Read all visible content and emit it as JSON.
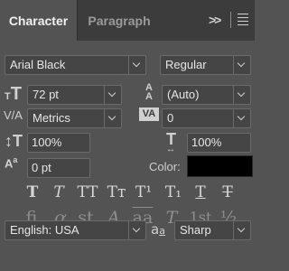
{
  "tabs": {
    "active": "Character",
    "inactive": "Paragraph"
  },
  "icons": {
    "collapse": "double-chevron-right-icon",
    "menu": "hamburger-menu-icon",
    "font_size": "font-size-icon",
    "leading": "leading-icon",
    "kerning": "kerning-icon",
    "tracking": "tracking-icon",
    "vertical_scale": "vertical-scale-icon",
    "horizontal_scale": "horizontal-scale-icon",
    "baseline_shift": "baseline-shift-icon",
    "anti_alias": "anti-aliasing-icon"
  },
  "font": {
    "family": "Arial Black",
    "style": "Regular"
  },
  "size": {
    "font_size": "72 pt",
    "leading": "(Auto)"
  },
  "spacing": {
    "kerning": "Metrics",
    "tracking": "0"
  },
  "scale": {
    "vertical": "100%",
    "horizontal": "100%"
  },
  "baseline": {
    "shift": "0 pt"
  },
  "color": {
    "label": "Color:",
    "value": "#000000"
  },
  "type_styles": {
    "faux_bold": "T",
    "faux_italic": "T",
    "all_caps": "TT",
    "small_caps": "Tт",
    "superscript": "T¹",
    "subscript": "T₁",
    "underline": "T",
    "strikethrough": "T"
  },
  "opentype": {
    "ligatures": "fi",
    "alternates": "ơ",
    "discretionary": "st",
    "swash": "A",
    "titling": "aa",
    "ordinals_caps": "T",
    "ordinals": "1st",
    "fractions": "½"
  },
  "language": {
    "value": "English: USA",
    "aa_label": "a",
    "aa_sub": "a",
    "anti_alias": "Sharp"
  }
}
